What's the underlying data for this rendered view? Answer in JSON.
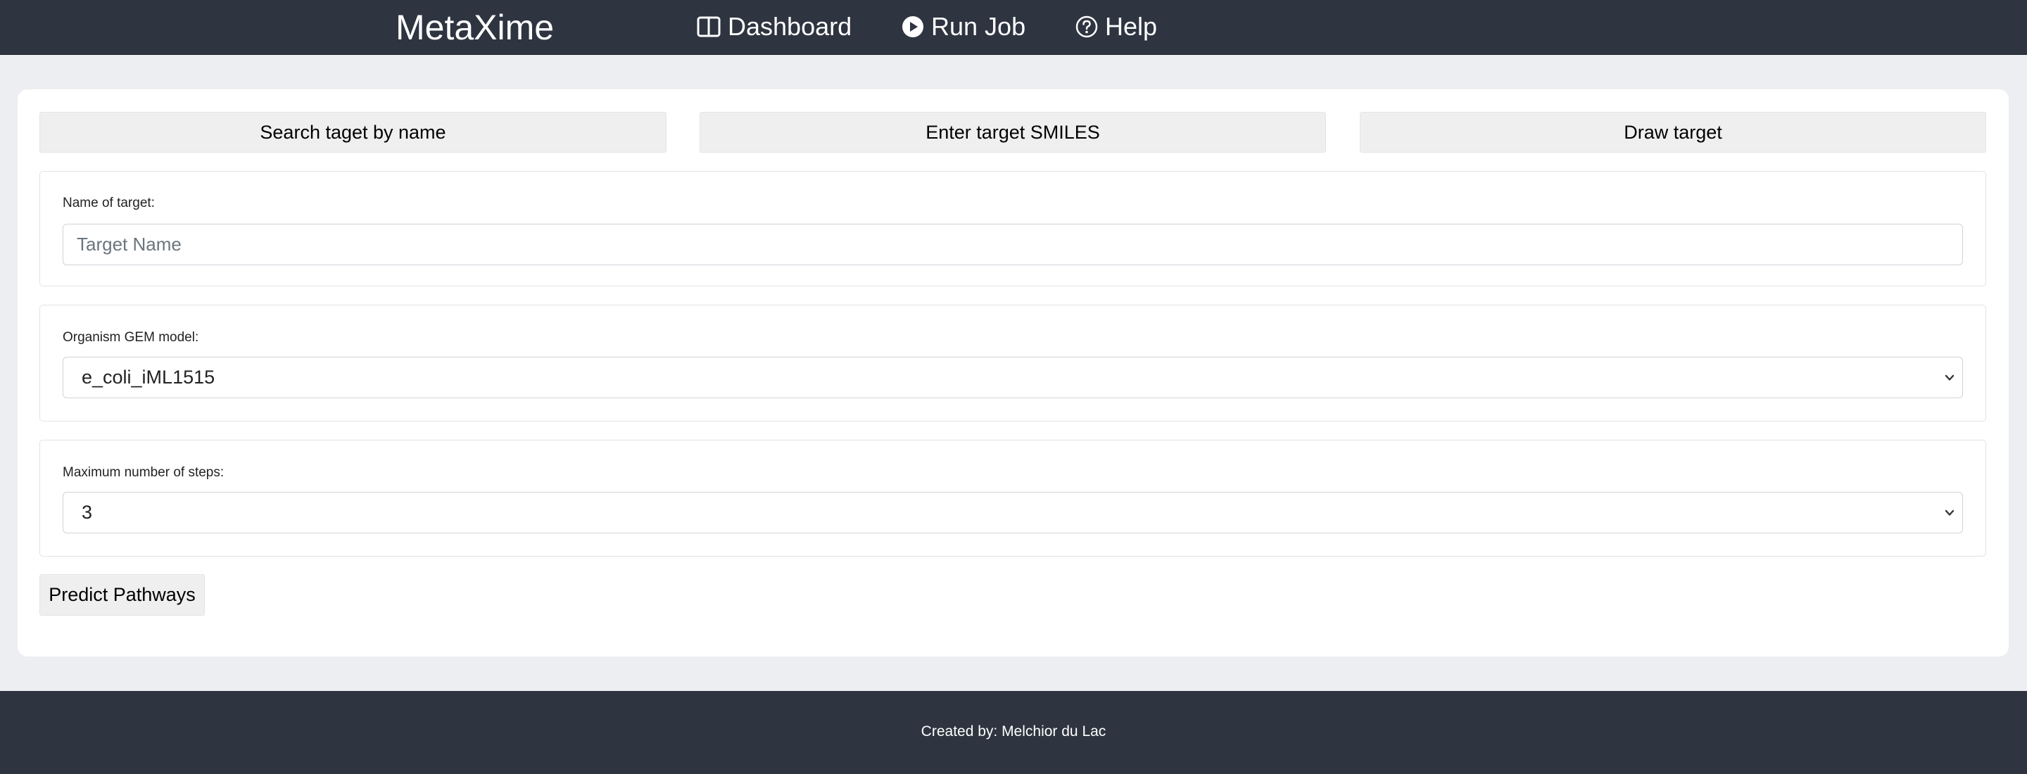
{
  "navbar": {
    "brand": "MetaXime",
    "items": [
      {
        "label": "Dashboard",
        "icon": "layout-columns-icon"
      },
      {
        "label": "Run Job",
        "icon": "play-circle-icon"
      },
      {
        "label": "Help",
        "icon": "question-circle-icon"
      }
    ]
  },
  "tabs": [
    {
      "label": "Search taget by name"
    },
    {
      "label": "Enter target SMILES"
    },
    {
      "label": "Draw target"
    }
  ],
  "target_name": {
    "label": "Name of target:",
    "placeholder": "Target Name",
    "value": ""
  },
  "organism_model": {
    "label": "Organism GEM model:",
    "selected": "e_coli_iML1515"
  },
  "max_steps": {
    "label": "Maximum number of steps:",
    "selected": "3"
  },
  "actions": {
    "predict_label": "Predict Pathways"
  },
  "footer": {
    "text": "Created by: Melchior du Lac"
  },
  "colors": {
    "navbar_bg": "#2e3440",
    "page_bg": "#edeef1",
    "button_bg": "#efefef"
  }
}
